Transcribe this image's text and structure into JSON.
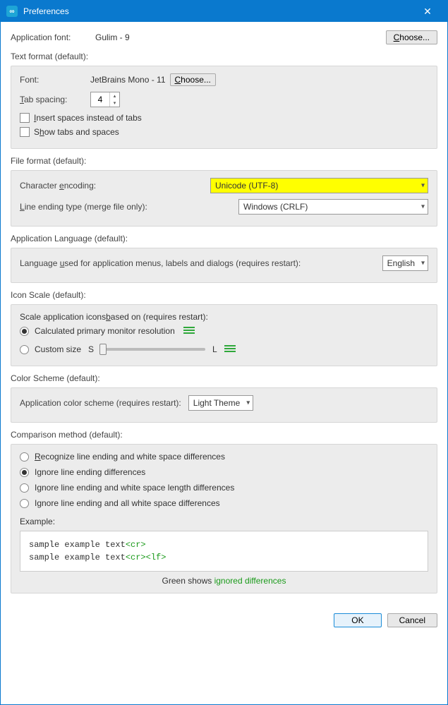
{
  "window": {
    "title": "Preferences"
  },
  "appFont": {
    "label": "Application font:",
    "value": "Gulim - 9",
    "chooseLabel": "Choose..."
  },
  "textFormat": {
    "sectionLabel": "Text format (default):",
    "fontLabel": "Font:",
    "fontValue": "JetBrains Mono - 11",
    "chooseLabel": "Choose...",
    "tabSpacingLabel": "Tab spacing:",
    "tabSpacingValue": "4",
    "insertSpacesLabel": "Insert spaces instead of tabs",
    "showTabsLabel": "Show tabs and spaces"
  },
  "fileFormat": {
    "sectionLabel": "File format (default):",
    "charEncodingLabel": "Character encoding:",
    "charEncodingValue": "Unicode (UTF-8)",
    "lineEndingLabel": "Line ending type (merge file only):",
    "lineEndingValue": "Windows (CRLF)"
  },
  "appLanguage": {
    "sectionLabel": "Application Language (default):",
    "desc": "Language used for application menus, labels and dialogs (requires restart):",
    "value": "English"
  },
  "iconScale": {
    "sectionLabel": "Icon Scale (default):",
    "desc": "Scale application icons based on (requires restart):",
    "opt1": "Calculated primary monitor resolution",
    "opt2": "Custom size",
    "sLabel": "S",
    "lLabel": "L"
  },
  "colorScheme": {
    "sectionLabel": "Color Scheme (default):",
    "desc": "Application color scheme (requires restart):",
    "value": "Light Theme"
  },
  "comparison": {
    "sectionLabel": "Comparison method (default):",
    "opt1": "Recognize line ending and white space differences",
    "opt2": "Ignore line ending differences",
    "opt3": "Ignore line ending and white space length differences",
    "opt4": "Ignore line ending and all white space differences",
    "exampleLabel": "Example:",
    "exampleLine1a": "sample example text",
    "exampleMarker1": "<cr>",
    "exampleLine2a": "sample example text",
    "exampleMarker2a": "<cr>",
    "exampleMarker2b": "<lf>",
    "footerNotePlain": "Green shows ",
    "footerNoteGreen": "ignored differences"
  },
  "buttons": {
    "ok": "OK",
    "cancel": "Cancel"
  }
}
